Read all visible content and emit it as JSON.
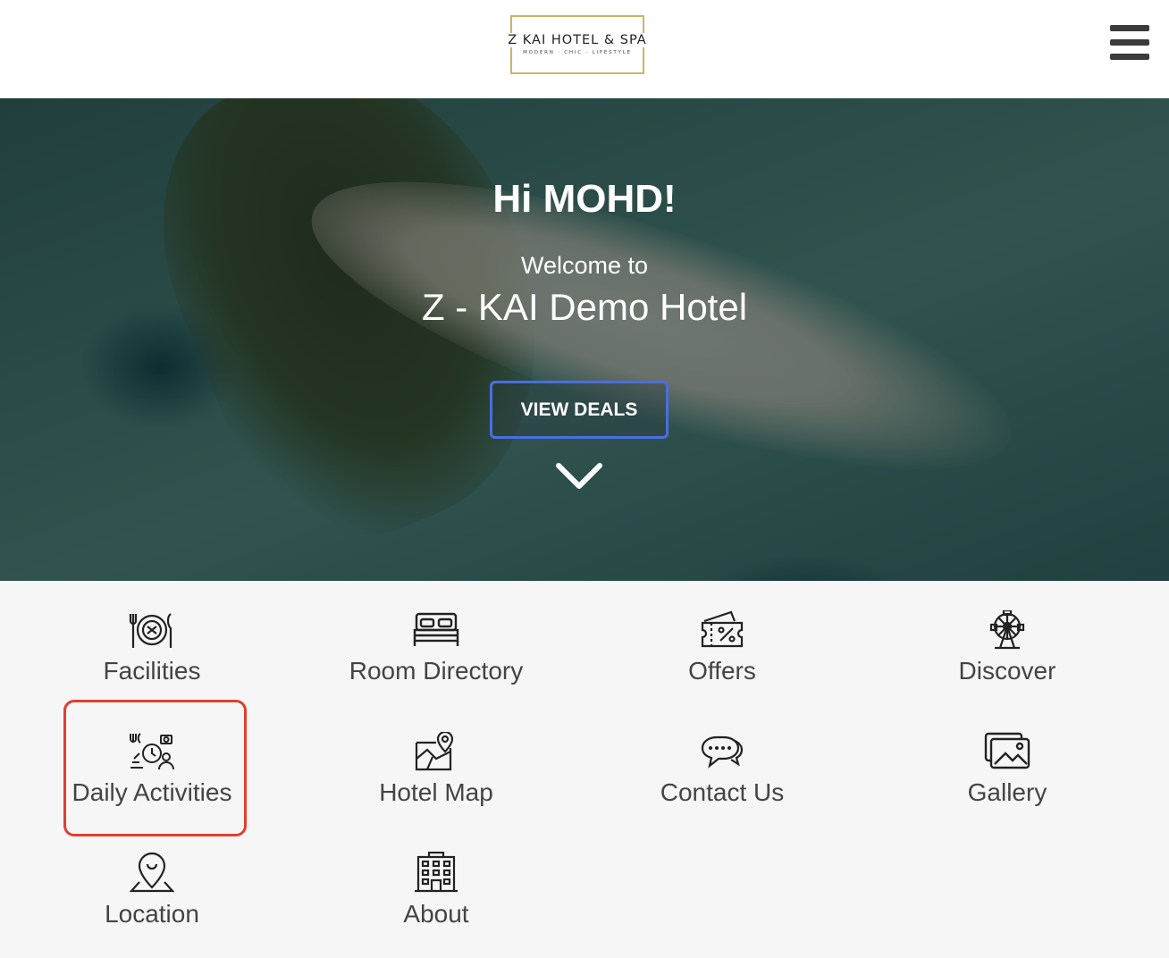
{
  "header": {
    "logo": {
      "name": "Z KAI HOTEL & SPA",
      "tagline": "MODERN · CHIC · LIFESTYLE"
    },
    "menu_icon": "hamburger-menu-icon"
  },
  "hero": {
    "greeting": "Hi MOHD!",
    "welcome": "Welcome to",
    "hotel_name": "Z - KAI Demo Hotel",
    "cta": "VIEW DEALS",
    "scroll_icon": "chevron-down-icon"
  },
  "menu": [
    {
      "label": "Facilities",
      "icon": "dining-icon"
    },
    {
      "label": "Room Directory",
      "icon": "bed-icon"
    },
    {
      "label": "Offers",
      "icon": "discount-ticket-icon"
    },
    {
      "label": "Discover",
      "icon": "ferris-wheel-icon"
    },
    {
      "label": "Daily Activities",
      "icon": "activities-icon"
    },
    {
      "label": "Hotel Map",
      "icon": "map-icon"
    },
    {
      "label": "Contact Us",
      "icon": "chat-bubbles-icon"
    },
    {
      "label": "Gallery",
      "icon": "photo-gallery-icon"
    },
    {
      "label": "Location",
      "icon": "location-pin-icon"
    },
    {
      "label": "About",
      "icon": "building-icon"
    }
  ],
  "colors": {
    "accent": "#4a6ee0",
    "highlight": "#e0402e",
    "logo_gold": "#cbb468"
  }
}
